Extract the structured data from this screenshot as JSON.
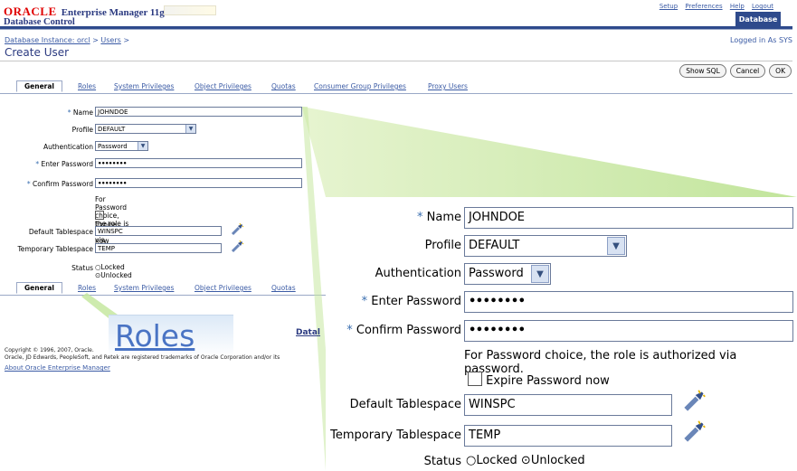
{
  "header": {
    "brand_oracle": "ORACLE",
    "brand_product": "Enterprise Manager 11g",
    "brand_sub": "Database Control",
    "links": [
      "Setup",
      "Preferences",
      "Help",
      "Logout"
    ],
    "database_tab": "Database"
  },
  "breadcrumb": {
    "database_instance": "Database Instance: orcl",
    "users": "Users",
    "sep": ">"
  },
  "logged_in": "Logged in As SYS",
  "page_title": "Create User",
  "buttons": {
    "show_sql": "Show SQL",
    "cancel": "Cancel",
    "ok": "OK"
  },
  "tabs": [
    "General",
    "Roles",
    "System Privileges",
    "Object Privileges",
    "Quotas",
    "Consumer Group Privileges",
    "Proxy Users"
  ],
  "bottom_tabs": [
    "General",
    "Roles",
    "System Privileges",
    "Object Privileges",
    "Quotas"
  ],
  "form": {
    "required_mark": "*",
    "name_label": "Name",
    "name_value": "JOHNDOE",
    "profile_label": "Profile",
    "profile_value": "DEFAULT",
    "auth_label": "Authentication",
    "auth_value": "Password",
    "enter_password_label": "Enter Password",
    "enter_password_value": "••••••••",
    "confirm_password_label": "Confirm Password",
    "confirm_password_value": "••••••••",
    "note": "For Password choice, the role is authorized via password.",
    "expire_label": "Expire Password now",
    "default_ts_label": "Default Tablespace",
    "default_ts_small": "WINSPC",
    "default_ts_zoom": "WINSPC",
    "temp_ts_label": "Temporary Tablespace",
    "temp_ts_value": "TEMP",
    "status_label": "Status",
    "status_locked": "Locked",
    "status_unlocked": "Unlocked"
  },
  "footer": {
    "database_link": "Datal",
    "copyright_1": "Copyright © 1996, 2007, Oracle.",
    "copyright_2": "Oracle, JD Edwards, PeopleSoft, and Retek are registered trademarks of Oracle Corporation and/or its",
    "about": "About Oracle Enterprise Manager"
  },
  "callout": {
    "roles_zoom": "Roles"
  },
  "icons": [
    "flashlight-search-icon",
    "dropdown-arrow-icon"
  ],
  "colors": {
    "accent": "#2e4a8c",
    "link": "#3b5ba5",
    "callout": "#b7e08a"
  }
}
